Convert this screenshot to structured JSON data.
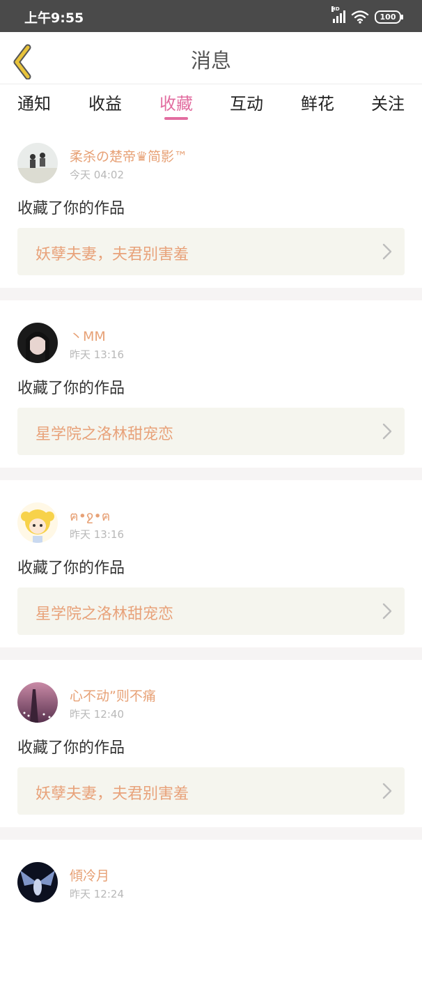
{
  "status_bar": {
    "time": "上午9:55",
    "network_label": "HD",
    "battery": "100"
  },
  "header": {
    "title": "消息"
  },
  "tabs": [
    {
      "label": "通知"
    },
    {
      "label": "收益"
    },
    {
      "label": "收藏"
    },
    {
      "label": "互动"
    },
    {
      "label": "鲜花"
    },
    {
      "label": "关注"
    }
  ],
  "active_tab": "收藏",
  "colors": {
    "accent": "#e26da0",
    "username": "#e7a176",
    "work_title": "#e8a27a",
    "back_icon": "#e8c33a"
  },
  "notifications": [
    {
      "username": "柔杀の楚帝♛简影™",
      "time": "今天 04:02",
      "action": "收藏了你的作品",
      "work_title": "妖孽夫妻，夫君别害羞"
    },
    {
      "username": "丶MM",
      "time": "昨天 13:16",
      "action": "收藏了你的作品",
      "work_title": "星学院之洛林甜宠恋"
    },
    {
      "username": "ฅ•ջ•ฅ",
      "time": "昨天 13:16",
      "action": "收藏了你的作品",
      "work_title": "星学院之洛林甜宠恋"
    },
    {
      "username": "心不动”则不痛",
      "time": "昨天 12:40",
      "action": "收藏了你的作品",
      "work_title": "妖孽夫妻，夫君别害羞"
    },
    {
      "username": "傾冷月",
      "time": "昨天 12:24"
    }
  ]
}
